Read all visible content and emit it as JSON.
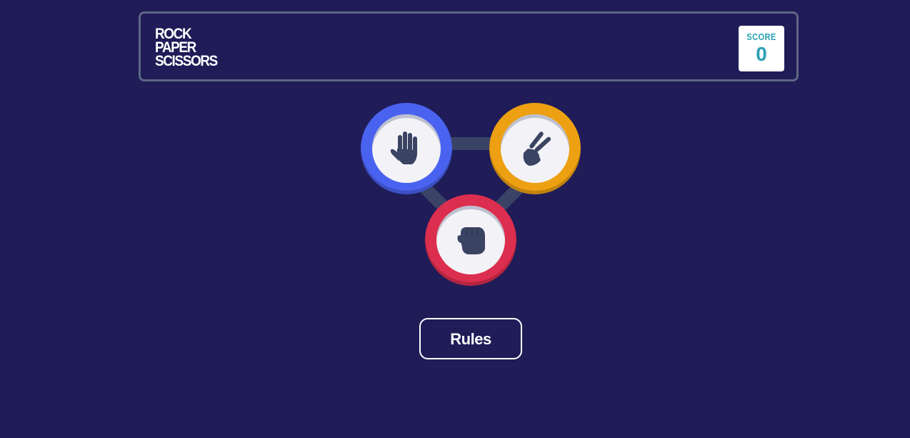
{
  "header": {
    "title_lines": [
      "ROCK",
      "PAPER",
      "SCISSORS"
    ],
    "score_label": "SCORE",
    "score_value": "0"
  },
  "tokens": [
    {
      "name": "paper",
      "icon": "paper-hand-icon",
      "ring_color": "#4a62f0"
    },
    {
      "name": "scissors",
      "icon": "scissors-hand-icon",
      "ring_color": "#eca012"
    },
    {
      "name": "rock",
      "icon": "rock-fist-icon",
      "ring_color": "#dc2e4e"
    }
  ],
  "rules_button": {
    "label": "Rules"
  },
  "colors": {
    "background": "#1f1c58",
    "header_border": "#5d6785",
    "score_text": "#2a9fb2",
    "icon": "#3b4363"
  }
}
